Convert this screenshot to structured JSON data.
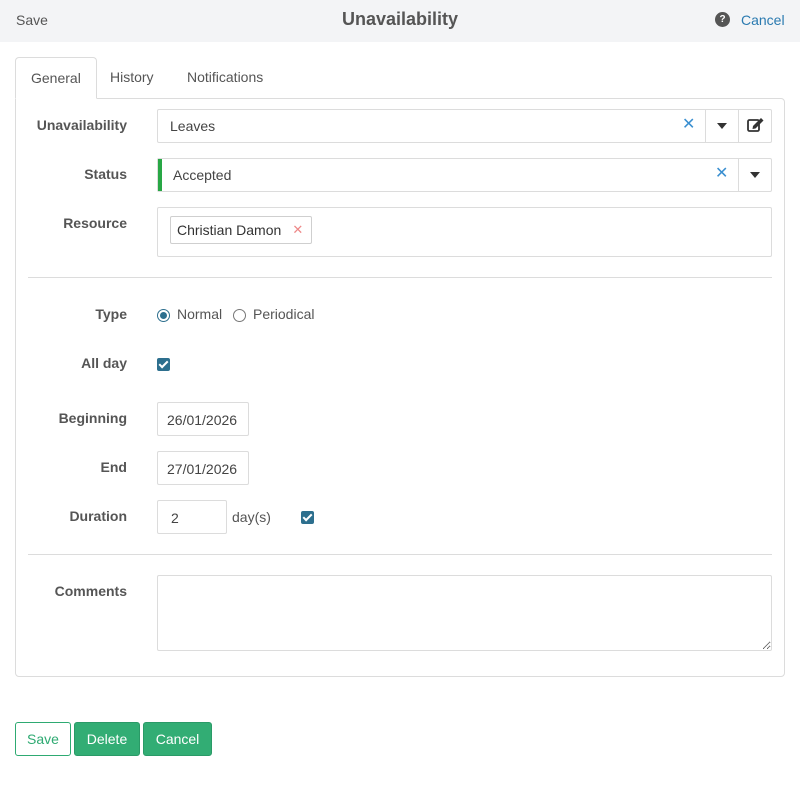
{
  "header": {
    "save_label": "Save",
    "title": "Unavailability",
    "help_glyph": "?",
    "cancel_label": "Cancel"
  },
  "tabs": [
    {
      "label": "General",
      "active": true
    },
    {
      "label": "History",
      "active": false
    },
    {
      "label": "Notifications",
      "active": false
    }
  ],
  "form": {
    "unavailability": {
      "label": "Unavailability",
      "value": "Leaves"
    },
    "status": {
      "label": "Status",
      "value": "Accepted",
      "color": "#28a745"
    },
    "resource": {
      "label": "Resource",
      "tags": [
        "Christian Damon"
      ]
    },
    "type": {
      "label": "Type",
      "options": [
        "Normal",
        "Periodical"
      ],
      "selected": "Normal"
    },
    "all_day": {
      "label": "All day",
      "checked": true
    },
    "beginning": {
      "label": "Beginning",
      "value": "26/01/2026"
    },
    "end": {
      "label": "End",
      "value": "27/01/2026"
    },
    "duration": {
      "label": "Duration",
      "value": "2",
      "unit": "day(s)",
      "checked": true
    },
    "comments": {
      "label": "Comments",
      "value": ""
    }
  },
  "footer": {
    "save_label": "Save",
    "delete_label": "Delete",
    "cancel_label": "Cancel"
  },
  "colors": {
    "accent": "#32ad74",
    "link": "#2a7ab0",
    "checkbox": "#2d6f8e"
  }
}
